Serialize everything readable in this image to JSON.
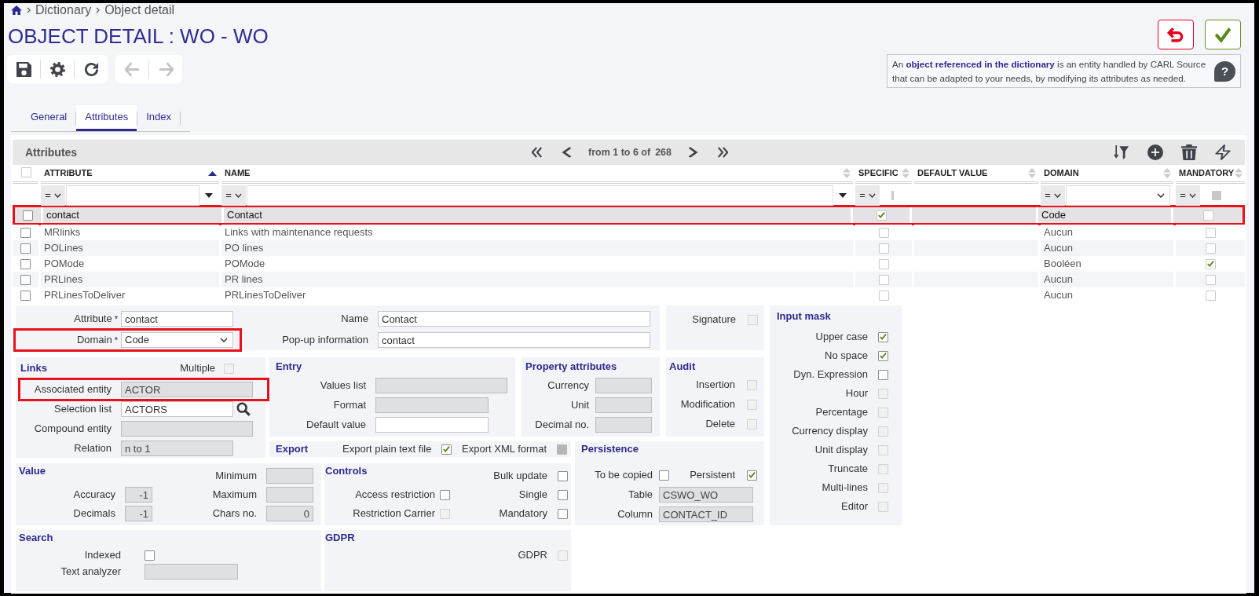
{
  "breadcrumb": {
    "items": [
      "Dictionary",
      "Object detail"
    ]
  },
  "title": "OBJECT DETAIL : WO - WO",
  "toolbar": [
    [
      {
        "kind": "save",
        "disabled": false
      },
      {
        "kind": "settings",
        "disabled": false
      },
      {
        "kind": "refresh",
        "disabled": false
      }
    ],
    [
      {
        "kind": "back",
        "disabled": true
      },
      {
        "kind": "forward",
        "disabled": true
      }
    ]
  ],
  "header_buttons": [
    {
      "kind": "undo"
    },
    {
      "kind": "confirm"
    }
  ],
  "info": {
    "text": "An **object referenced in the dictionary** is an entity handled by CARL Source that can be adapted to your needs, by modifying its attributes as needed.",
    "help": "?"
  },
  "tabs": [
    {
      "label": "General",
      "selected": false
    },
    {
      "label": "Attributes",
      "selected": true
    },
    {
      "label": "Index",
      "selected": false
    }
  ],
  "grid": {
    "title": "Attributes",
    "pager": {
      "buttons": [
        {
          "kind": "first"
        },
        {
          "kind": "previous"
        },
        {
          "kind": "next"
        },
        {
          "kind": "last"
        }
      ],
      "range": "from 1 to 6 of",
      "total": "268"
    },
    "tools": [
      {
        "kind": "sort-filter"
      },
      {
        "kind": "add"
      },
      {
        "kind": "delete"
      },
      {
        "kind": "action"
      }
    ],
    "select_all": {
      "checked": false
    },
    "columns": [
      {
        "label": "ATTRIBUTE",
        "sorted": true,
        "filter": {
          "kind": "text",
          "operator": "="
        }
      },
      {
        "label": "NAME",
        "sorted": false,
        "filter": {
          "kind": "text",
          "operator": "="
        }
      },
      {
        "label": "SPECIFIC",
        "sorted": false,
        "filter": {
          "kind": "bar",
          "operator": "="
        }
      },
      {
        "label": "DEFAULT VALUE",
        "sorted": false
      },
      {
        "label": "DOMAIN",
        "sorted": false,
        "filter": {
          "kind": "select",
          "operator": "="
        }
      },
      {
        "label": "MANDATORY",
        "sorted": false,
        "filter": {
          "kind": "check",
          "operator": "=",
          "indeterminate": true
        }
      }
    ],
    "rows": [
      {
        "checked": false,
        "selected": true,
        "highlighted": true,
        "attribute": "contact",
        "name": "Contact",
        "specific": true,
        "domain": "Code",
        "mandatory": false
      },
      {
        "checked": false,
        "selected": false,
        "highlighted": false,
        "attribute": "MRlinks",
        "name": "Links with maintenance requests",
        "specific": false,
        "domain": "Aucun",
        "mandatory": false
      },
      {
        "checked": false,
        "selected": false,
        "highlighted": false,
        "attribute": "POLines",
        "name": "PO lines",
        "specific": false,
        "domain": "Aucun",
        "mandatory": false
      },
      {
        "checked": false,
        "selected": false,
        "highlighted": false,
        "attribute": "POMode",
        "name": "POMode",
        "specific": false,
        "domain": "Booléen",
        "mandatory": true
      },
      {
        "checked": false,
        "selected": false,
        "highlighted": false,
        "attribute": "PRLines",
        "name": "PR lines",
        "specific": false,
        "domain": "Aucun",
        "mandatory": false
      },
      {
        "checked": false,
        "selected": false,
        "highlighted": false,
        "attribute": "PRLinesToDeliver",
        "name": "PRLinesToDeliver",
        "specific": false,
        "domain": "Aucun",
        "mandatory": false
      }
    ]
  },
  "form": {
    "general": {
      "items": [
        {
          "kind": "text",
          "label": "Attribute",
          "mark": "*",
          "value": "contact",
          "readonly": false,
          "highlighted": false
        },
        {
          "kind": "text",
          "label": "Name",
          "value": "Contact",
          "readonly": false,
          "highlighted": false
        },
        {
          "kind": "select",
          "label": "Domain",
          "mark": "*",
          "value": "Code",
          "readonly": false,
          "highlighted": true
        },
        {
          "kind": "text",
          "label": "Pop-up information",
          "value": "contact",
          "readonly": false,
          "highlighted": false
        }
      ]
    },
    "signature": {
      "items": [
        {
          "kind": "checkbox",
          "label": "Signature",
          "checked": false,
          "disabled": true
        }
      ]
    },
    "input_mask": {
      "title": "Input mask",
      "items": [
        {
          "kind": "checkbox",
          "label": "Upper case",
          "checked": true,
          "disabled": false
        },
        {
          "kind": "checkbox",
          "label": "No space",
          "checked": true,
          "disabled": false
        },
        {
          "kind": "checkbox",
          "label": "Dyn. Expression",
          "checked": false,
          "disabled": false
        },
        {
          "kind": "checkbox",
          "label": "Hour",
          "checked": false,
          "disabled": true
        },
        {
          "kind": "checkbox",
          "label": "Percentage",
          "checked": false,
          "disabled": true
        },
        {
          "kind": "checkbox",
          "label": "Currency display",
          "checked": false,
          "disabled": true
        },
        {
          "kind": "checkbox",
          "label": "Unit display",
          "checked": false,
          "disabled": true
        },
        {
          "kind": "checkbox",
          "label": "Truncate",
          "checked": false,
          "disabled": true
        },
        {
          "kind": "checkbox",
          "label": "Multi-lines",
          "checked": false,
          "disabled": true
        },
        {
          "kind": "checkbox",
          "label": "Editor",
          "checked": false,
          "disabled": true
        }
      ]
    },
    "links": {
      "title": "Links",
      "option": {
        "kind": "checkbox",
        "label": "Multiple",
        "checked": false,
        "disabled": true
      },
      "items": [
        {
          "kind": "text",
          "label": "Associated entity",
          "value": "ACTOR",
          "readonly": true,
          "highlighted": true
        },
        {
          "kind": "lookup",
          "label": "Selection list",
          "value": "ACTORS",
          "readonly": false,
          "highlighted": false
        },
        {
          "kind": "text",
          "label": "Compound entity",
          "readonly": true,
          "highlighted": false
        },
        {
          "kind": "text",
          "label": "Relation",
          "value": "n to 1",
          "readonly": true,
          "highlighted": false
        }
      ]
    },
    "entry": {
      "title": "Entry",
      "items": [
        {
          "kind": "text",
          "label": "Values list",
          "readonly": true
        },
        {
          "kind": "text",
          "label": "Format",
          "readonly": true
        },
        {
          "kind": "text",
          "label": "Default value",
          "readonly": false
        }
      ]
    },
    "property_attributes": {
      "title": "Property attributes",
      "items": [
        {
          "kind": "text",
          "label": "Currency",
          "readonly": true
        },
        {
          "kind": "text",
          "label": "Unit",
          "readonly": true
        },
        {
          "kind": "text",
          "label": "Decimal no.",
          "readonly": true
        }
      ]
    },
    "audit": {
      "title": "Audit",
      "items": [
        {
          "kind": "checkbox",
          "label": "Insertion",
          "checked": false,
          "disabled": true
        },
        {
          "kind": "checkbox",
          "label": "Modification",
          "checked": false,
          "disabled": true
        },
        {
          "kind": "checkbox",
          "label": "Delete",
          "checked": false,
          "disabled": true
        }
      ]
    },
    "export": {
      "title": "Export",
      "items": [
        {
          "kind": "checkbox",
          "label": "Export plain text file",
          "checked": true,
          "disabled": false
        },
        {
          "kind": "checkbox",
          "label": "Export XML format",
          "checked": true,
          "disabled": true
        }
      ]
    },
    "persistence": {
      "title": "Persistence",
      "items": [
        {
          "kind": "checkbox",
          "label": "To be copied",
          "checked": false,
          "disabled": false
        },
        {
          "kind": "checkbox",
          "label": "Persistent",
          "checked": true,
          "disabled": false
        },
        {
          "kind": "text",
          "label": "Table",
          "value": "CSWO_WO",
          "readonly": true
        },
        {
          "kind": "text",
          "label": "Column",
          "value": "CONTACT_ID",
          "readonly": true
        }
      ]
    },
    "value": {
      "title": "Value",
      "items": [
        {
          "kind": "number",
          "label": "Minimum",
          "readonly": true
        },
        {
          "kind": "number",
          "label": "Accuracy",
          "value": "-1",
          "readonly": true
        },
        {
          "kind": "number",
          "label": "Maximum",
          "readonly": true
        },
        {
          "kind": "number",
          "label": "Decimals",
          "value": "-1",
          "readonly": true
        },
        {
          "kind": "number",
          "label": "Chars no.",
          "value": "0",
          "readonly": true
        }
      ]
    },
    "controls": {
      "title": "Controls",
      "items": [
        {
          "kind": "checkbox",
          "label": "Bulk update",
          "checked": false,
          "disabled": false
        },
        {
          "kind": "checkbox",
          "label": "Access restriction",
          "checked": false,
          "disabled": false
        },
        {
          "kind": "checkbox",
          "label": "Single",
          "checked": false,
          "disabled": false
        },
        {
          "kind": "checkbox",
          "label": "Restriction Carrier",
          "checked": false,
          "disabled": true
        },
        {
          "kind": "checkbox",
          "label": "Mandatory",
          "checked": false,
          "disabled": false
        }
      ]
    },
    "search": {
      "title": "Search",
      "items": [
        {
          "kind": "checkbox",
          "label": "Indexed",
          "checked": false,
          "disabled": false
        },
        {
          "kind": "text",
          "label": "Text analyzer",
          "readonly": true
        }
      ]
    },
    "gdpr": {
      "title": "GDPR",
      "items": [
        {
          "kind": "checkbox",
          "label": "GDPR",
          "checked": false,
          "disabled": true
        }
      ]
    }
  }
}
